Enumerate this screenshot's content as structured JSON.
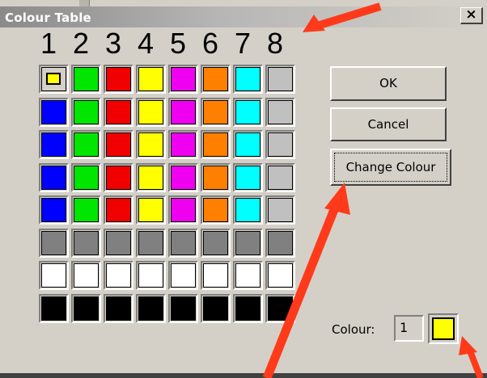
{
  "window": {
    "title": "Colour Table",
    "close_label": "×"
  },
  "columns": [
    "1",
    "2",
    "3",
    "4",
    "5",
    "6",
    "7",
    "8"
  ],
  "palette": {
    "rows": [
      [
        "#ffff00",
        "#00e600",
        "#f00000",
        "#ffff00",
        "#f000f0",
        "#ff8000",
        "#00ffff",
        "#c0c0c0"
      ],
      [
        "#0000ff",
        "#00e600",
        "#f00000",
        "#ffff00",
        "#f000f0",
        "#ff8000",
        "#00ffff",
        "#c0c0c0"
      ],
      [
        "#0000ff",
        "#00e600",
        "#f00000",
        "#ffff00",
        "#f000f0",
        "#ff8000",
        "#00ffff",
        "#c0c0c0"
      ],
      [
        "#0000ff",
        "#00e600",
        "#f00000",
        "#ffff00",
        "#f000f0",
        "#ff8000",
        "#00ffff",
        "#c0c0c0"
      ],
      [
        "#0000ff",
        "#00e600",
        "#f00000",
        "#ffff00",
        "#f000f0",
        "#ff8000",
        "#00ffff",
        "#c0c0c0"
      ],
      [
        "#808080",
        "#808080",
        "#808080",
        "#808080",
        "#808080",
        "#808080",
        "#808080",
        "#808080"
      ],
      [
        "#ffffff",
        "#ffffff",
        "#ffffff",
        "#ffffff",
        "#ffffff",
        "#ffffff",
        "#ffffff",
        "#ffffff"
      ],
      [
        "#000000",
        "#000000",
        "#000000",
        "#000000",
        "#000000",
        "#000000",
        "#000000",
        "#000000"
      ]
    ],
    "selected": {
      "row": 0,
      "col": 0
    }
  },
  "buttons": {
    "ok": "OK",
    "cancel": "Cancel",
    "change": "Change Colour"
  },
  "colour": {
    "label": "Colour:",
    "value": "1",
    "preview": "#ffff00"
  },
  "colors": {
    "face": "#d4d0c8",
    "annotation_arrow": "#ff3a1a"
  }
}
